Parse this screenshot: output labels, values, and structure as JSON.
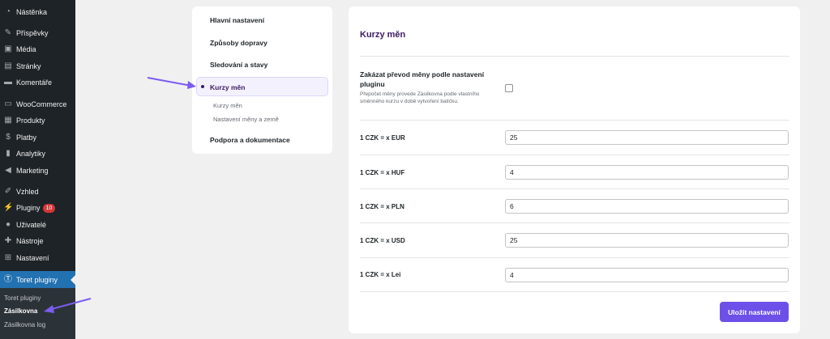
{
  "sidebar": {
    "items": [
      {
        "label": "Nástěnka",
        "icon": "dashboard-icon"
      },
      {
        "label": "Příspěvky",
        "icon": "pin-icon"
      },
      {
        "label": "Média",
        "icon": "media-icon"
      },
      {
        "label": "Stránky",
        "icon": "page-icon"
      },
      {
        "label": "Komentáře",
        "icon": "comment-icon"
      },
      {
        "label": "WooCommerce",
        "icon": "woo-icon"
      },
      {
        "label": "Produkty",
        "icon": "archive-icon"
      },
      {
        "label": "Platby",
        "icon": "payments-icon"
      },
      {
        "label": "Analytiky",
        "icon": "chart-icon"
      },
      {
        "label": "Marketing",
        "icon": "megaphone-icon"
      },
      {
        "label": "Vzhled",
        "icon": "brush-icon"
      },
      {
        "label": "Pluginy",
        "icon": "plugin-icon",
        "badge": "10"
      },
      {
        "label": "Uživatelé",
        "icon": "user-icon"
      },
      {
        "label": "Nástroje",
        "icon": "wrench-icon"
      },
      {
        "label": "Nastavení",
        "icon": "settings-icon"
      },
      {
        "label": "Toret pluginy",
        "icon": "toret-icon"
      }
    ],
    "submenu": [
      "Toret pluginy",
      "Zásilkovna",
      "Zásilkovna log"
    ],
    "accent": "#2271b1"
  },
  "nav": {
    "links": [
      "Hlavní nastavení",
      "Způsoby dopravy",
      "Sledování a stavy",
      "Kurzy měn",
      "Podpora a dokumentace"
    ],
    "sub_links": [
      "Kurzy měn",
      "Nastavení měny a země"
    ],
    "active_color": "#3c1b63"
  },
  "main": {
    "title": "Kurzy měn",
    "toggle": {
      "label": "Zakázat převod měny podle nastavení pluginu",
      "description": "Přepočet měny provede Zásilkovna podle vlastního směnného kurzu v době vytvoření balíčku.",
      "checked": false
    },
    "rates": [
      {
        "label": "1 CZK = x EUR",
        "value": "25"
      },
      {
        "label": "1 CZK = x HUF",
        "value": "4"
      },
      {
        "label": "1 CZK = x PLN",
        "value": "6"
      },
      {
        "label": "1 CZK = x USD",
        "value": "25"
      },
      {
        "label": "1 CZK = x Lei",
        "value": "4"
      }
    ],
    "save_label": "Uložit nastavení",
    "button_color": "#6d50e8"
  }
}
